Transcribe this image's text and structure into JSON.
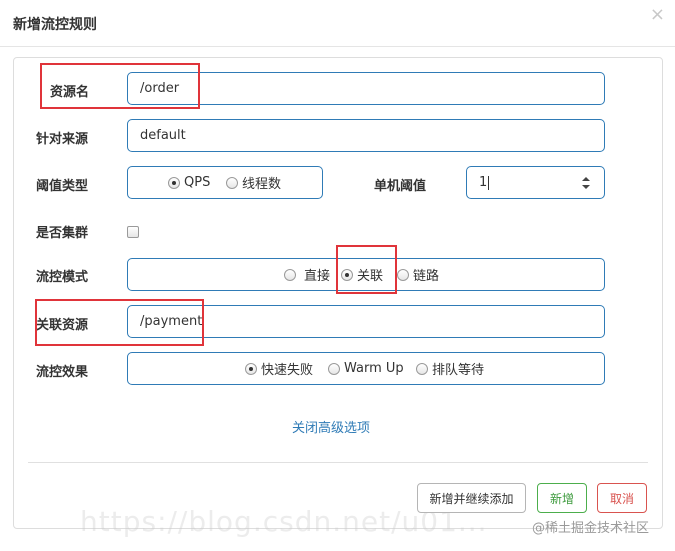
{
  "dialog": {
    "title": "新增流控规则",
    "close_glyph": "×"
  },
  "form": {
    "resource_name": {
      "label": "资源名",
      "value": "/order"
    },
    "limit_app": {
      "label": "针对来源",
      "value": "default"
    },
    "threshold_type": {
      "label": "阈值类型",
      "options": [
        "QPS",
        "线程数"
      ],
      "selected": "QPS"
    },
    "single_threshold": {
      "label": "单机阈值",
      "value": "1"
    },
    "cluster": {
      "label": "是否集群",
      "checked": false
    },
    "strategy": {
      "label": "流控模式",
      "options": [
        "直接",
        "关联",
        "链路"
      ],
      "selected": "关联"
    },
    "ref_resource": {
      "label": "关联资源",
      "value": "/payment"
    },
    "control_behavior": {
      "label": "流控效果",
      "options": [
        "快速失败",
        "Warm Up",
        "排队等待"
      ],
      "selected": "快速失败"
    }
  },
  "advanced_link": "关闭高级选项",
  "buttons": {
    "add_and_continue": "新增并继续添加",
    "add": "新增",
    "cancel": "取消"
  },
  "watermark": "@稀土掘金技术社区",
  "faint_watermark": "https://blog.csdn.net/u01..."
}
